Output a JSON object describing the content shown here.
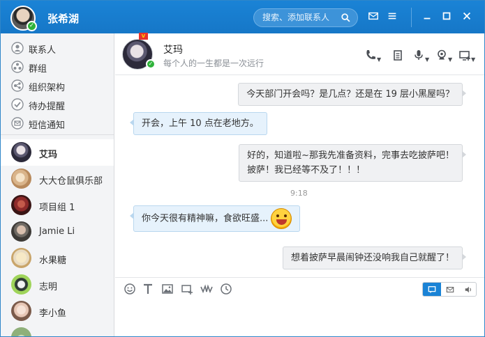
{
  "user": {
    "name": "张希湖"
  },
  "search": {
    "placeholder": "搜索、添加联系人"
  },
  "sidebar": {
    "menu": [
      {
        "label": "联系人",
        "icon": "contacts-icon"
      },
      {
        "label": "群组",
        "icon": "groups-icon"
      },
      {
        "label": "组织架构",
        "icon": "org-chart-icon"
      },
      {
        "label": "待办提醒",
        "icon": "todo-check-icon"
      },
      {
        "label": "短信通知",
        "icon": "sms-icon"
      }
    ],
    "contacts": [
      {
        "name": "艾玛",
        "color": "#5b5870",
        "active": true
      },
      {
        "name": "大大仓鼠俱乐部",
        "color": "#d9b48a"
      },
      {
        "name": "项目组 1",
        "color": "#8e2a2a"
      },
      {
        "name": "Jamie Li",
        "color": "#6f6a64"
      },
      {
        "name": "水果糖",
        "color": "#e9dcc3"
      },
      {
        "name": "志明",
        "color": "#2f3a35"
      },
      {
        "name": "李小鱼",
        "color": "#e7c7b6"
      }
    ]
  },
  "chat": {
    "peer_name": "艾玛",
    "peer_signature": "每个人的一生都是一次远行",
    "vip": "V",
    "messages": [
      {
        "dir": "out",
        "text": "今天部门开会吗？是几点？还是在 19 层小黑屋吗？"
      },
      {
        "dir": "in",
        "text": "开会，上午 10 点在老地方。"
      },
      {
        "dir": "out",
        "line1": "好的，知道啦~那我先准备资料，完事去吃披萨吧！",
        "line2": "披萨！我已经等不及了！！！"
      },
      {
        "dir": "time",
        "text": "9:18"
      },
      {
        "dir": "in",
        "text": "你今天很有精神嘛，食欲旺盛..."
      },
      {
        "dir": "out",
        "text": "想着披萨早晨闹钟还没响我自己就醒了！"
      }
    ]
  },
  "colors": {
    "titlebar": "#1a83d6",
    "online": "#2fb33a",
    "vip": "#e8332b"
  }
}
